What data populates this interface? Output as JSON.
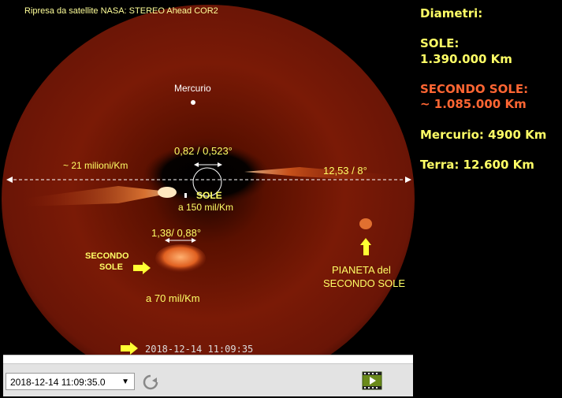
{
  "header": {
    "text": "Ripresa da satellite NASA: STEREO Ahead COR2"
  },
  "labels": {
    "mercurio": "Mercurio",
    "sole_angle": "0,82 / 0,523°",
    "distance_21": "~ 21 milioni/Km",
    "angle_12": "12,53 / 8°",
    "sole": "SOLE",
    "sole_dist": "a 150 mil/Km",
    "second_angle": "1,38/ 0,88°",
    "secondo_sole_1": "SECONDO",
    "secondo_sole_2": "SOLE",
    "second_dist": "a 70 mil/Km",
    "pianeta_1": "PIANETA del",
    "pianeta_2": "SECONDO SOLE",
    "timestamp": "2018-12-14 11:09:35"
  },
  "side_panel": {
    "title": "Diametri:",
    "sole_label": "SOLE:",
    "sole_value": "1.390.000 Km",
    "second_label": "SECONDO SOLE:",
    "second_value": "~ 1.085.000 Km",
    "mercurio": "Mercurio: 4900 Km",
    "terra": "Terra: 12.600 Km"
  },
  "player": {
    "datetime_select": "2018-12-14 11:09:35.0",
    "refresh_icon": "refresh-icon",
    "film_icon": "film-icon"
  },
  "colors": {
    "label_yellow": "#ffff66",
    "second_sun_orange": "#ff6633",
    "white": "#ffffff"
  }
}
